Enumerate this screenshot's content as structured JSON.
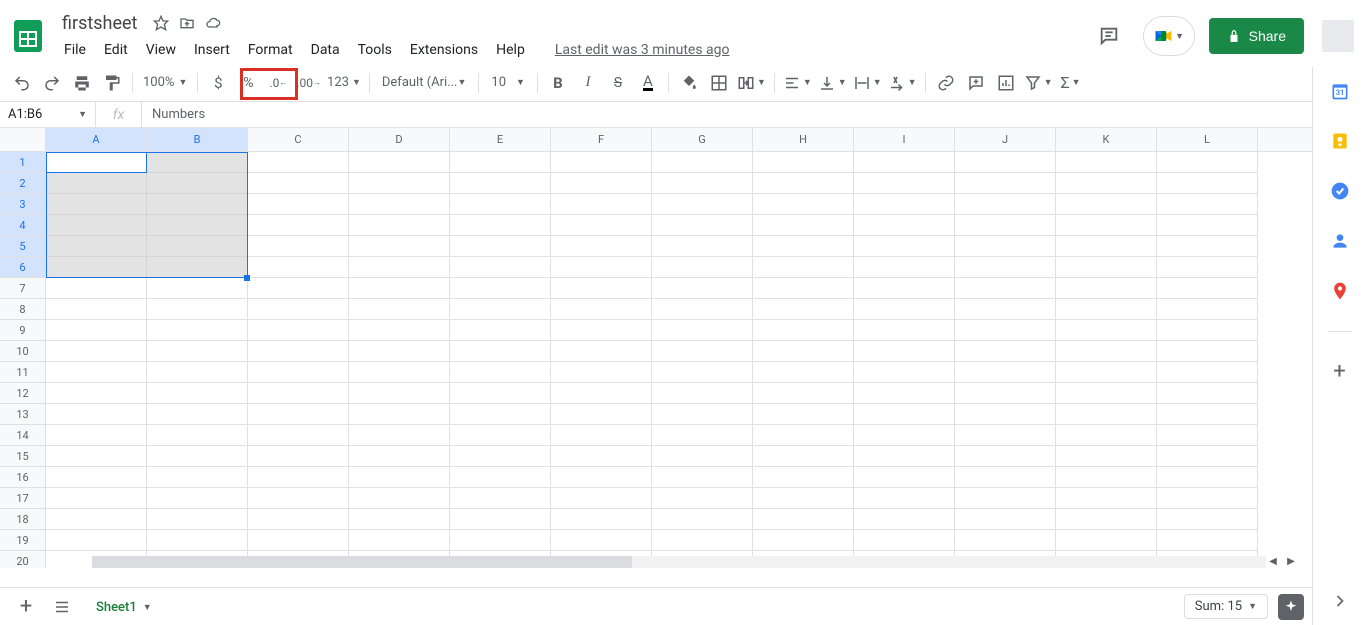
{
  "doc": {
    "title": "firstsheet"
  },
  "menus": [
    "File",
    "Edit",
    "View",
    "Insert",
    "Format",
    "Data",
    "Tools",
    "Extensions",
    "Help"
  ],
  "last_edit": "Last edit was 3 minutes ago",
  "share_label": "Share",
  "toolbar": {
    "zoom": "100%",
    "font": "Default (Ari...",
    "font_size": "10",
    "number_fmt": "123"
  },
  "name_box": "A1:B6",
  "formula_value": "Numbers",
  "columns": [
    "A",
    "B",
    "C",
    "D",
    "E",
    "F",
    "G",
    "H",
    "I",
    "J",
    "K",
    "L"
  ],
  "rows": [
    "1",
    "2",
    "3",
    "4",
    "5",
    "6",
    "7",
    "8",
    "9",
    "10",
    "11",
    "12",
    "13",
    "14",
    "15",
    "16",
    "17",
    "18",
    "19",
    "20"
  ],
  "selected_cols": [
    "A",
    "B"
  ],
  "selected_rows": [
    "1",
    "2",
    "3",
    "4",
    "5",
    "6"
  ],
  "sheet_tab": "Sheet1",
  "sum_text": "Sum: 15",
  "side_panel_apps": [
    "calendar",
    "keep",
    "tasks",
    "contacts",
    "maps"
  ]
}
